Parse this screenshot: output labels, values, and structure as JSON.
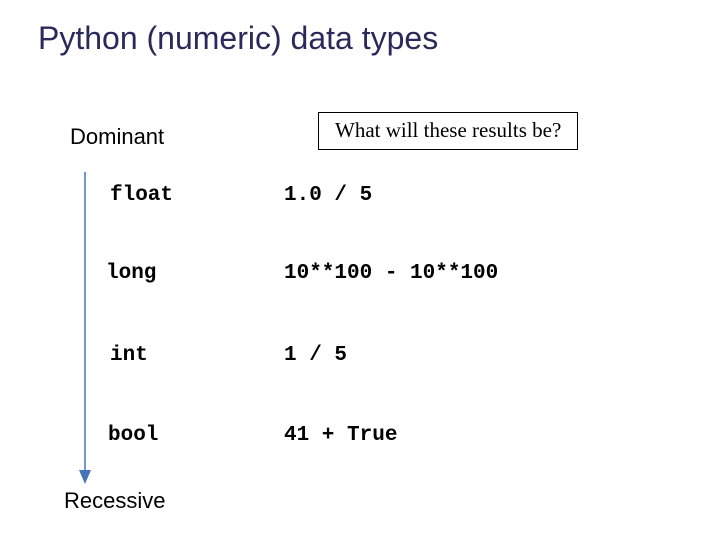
{
  "title": "Python (numeric) data types",
  "dominant": "Dominant",
  "recessive": "Recessive",
  "question": "What will these results be?",
  "types": {
    "float": "float",
    "long": "long",
    "int": "int",
    "bool": "bool"
  },
  "expressions": {
    "float": "1.0 / 5",
    "long": "10**100 - 10**100",
    "int": "1 / 5",
    "bool": "41 + True"
  },
  "arrow_color": "#4674b8"
}
